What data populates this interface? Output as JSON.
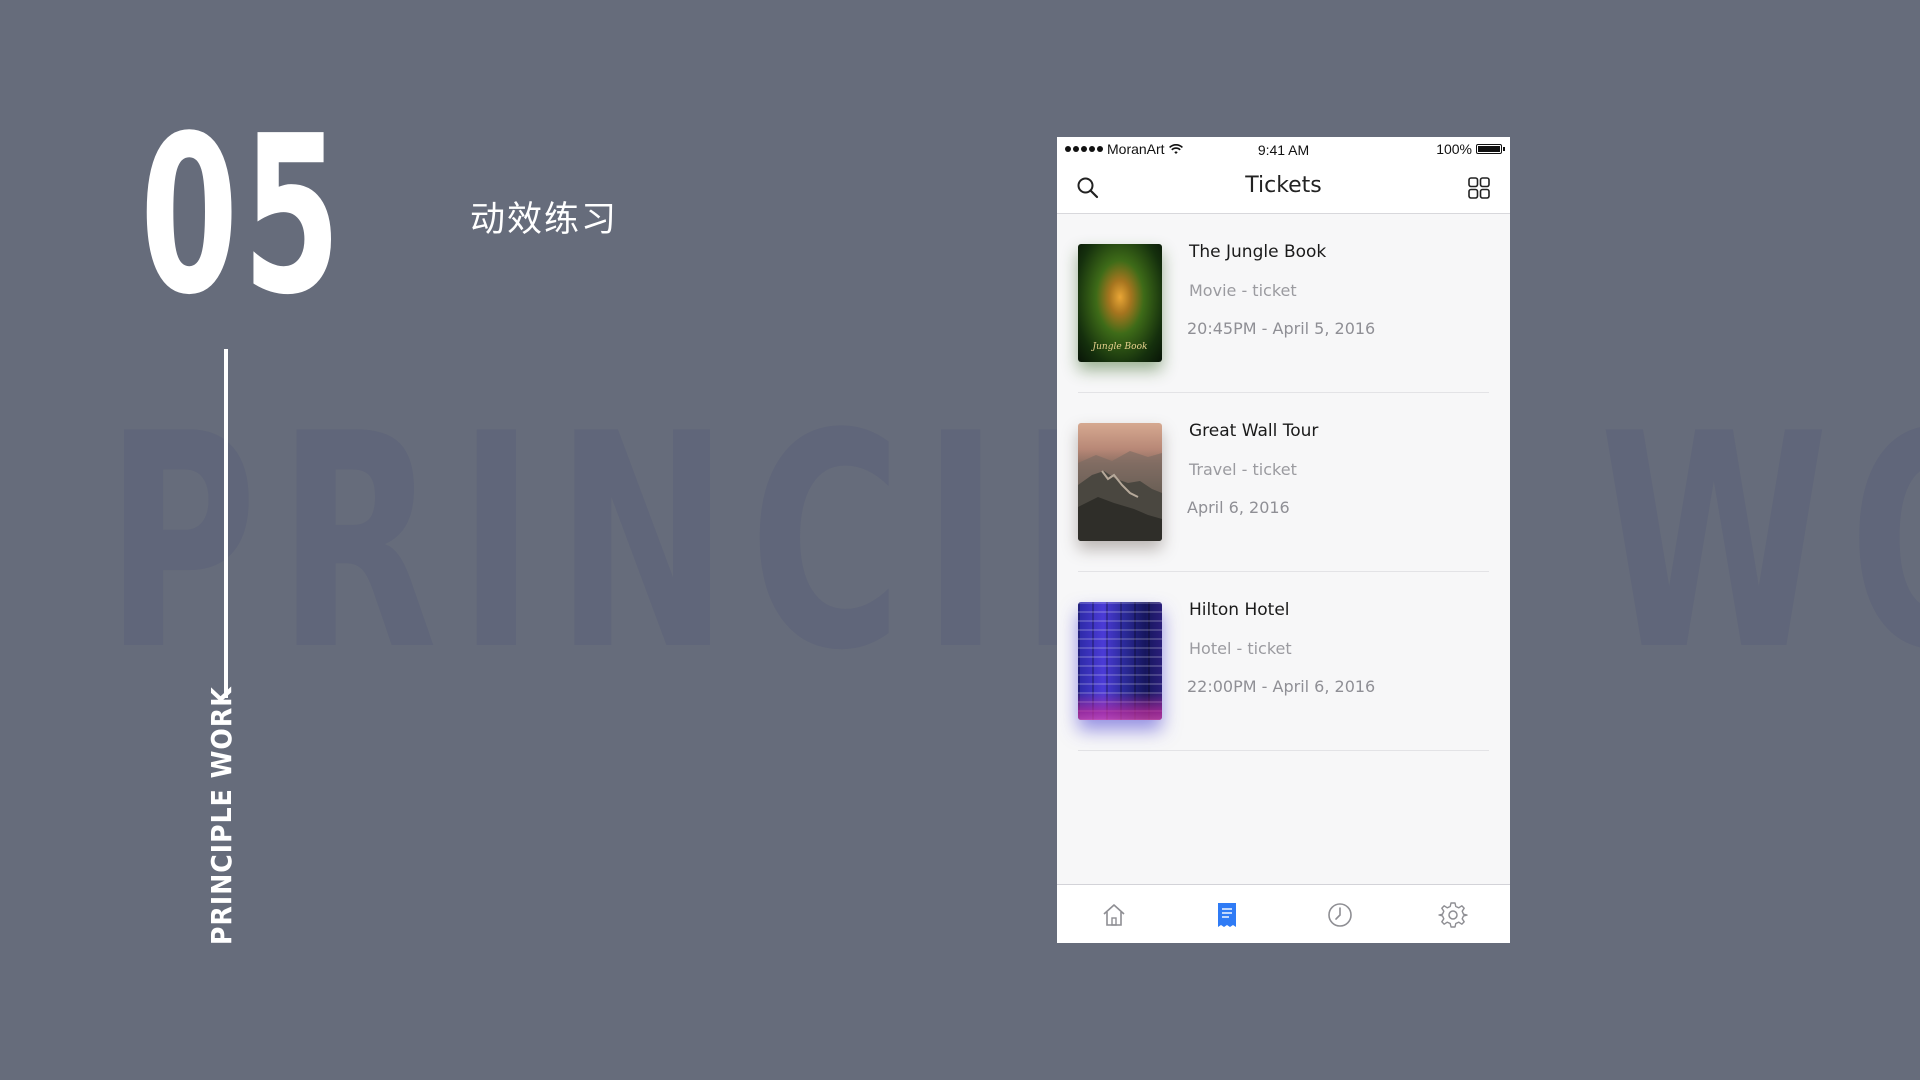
{
  "slide": {
    "number": "05",
    "subtitle": "动效练习",
    "watermark": "PRINCIPLE WORK",
    "vertical_label": "PRINCIPLE WORK"
  },
  "status_bar": {
    "carrier": "MoranArt",
    "time": "9:41 AM",
    "battery": "100%"
  },
  "nav": {
    "title": "Tickets",
    "left_icon": "search-icon",
    "right_icon": "grid-icon"
  },
  "tickets": [
    {
      "title": "The Jungle Book",
      "type": "Movie - ticket",
      "date": "20:45PM - April 5, 2016",
      "poster_caption": "Jungle Book"
    },
    {
      "title": "Great Wall Tour",
      "type": "Travel - ticket",
      "date": "April 6, 2016"
    },
    {
      "title": "Hilton Hotel",
      "type": "Hotel - ticket",
      "date": "22:00PM - April 6, 2016"
    }
  ],
  "tab_bar": {
    "tabs": [
      {
        "icon": "home-icon",
        "active": false
      },
      {
        "icon": "ticket-icon",
        "active": true
      },
      {
        "icon": "clock-icon",
        "active": false
      },
      {
        "icon": "gear-icon",
        "active": false
      }
    ],
    "active_color": "#2f7bf5",
    "inactive_color": "#8e8e93"
  },
  "colors": {
    "background": "#666c7b",
    "watermark": "#60667a",
    "accent": "#2f7bf5"
  }
}
